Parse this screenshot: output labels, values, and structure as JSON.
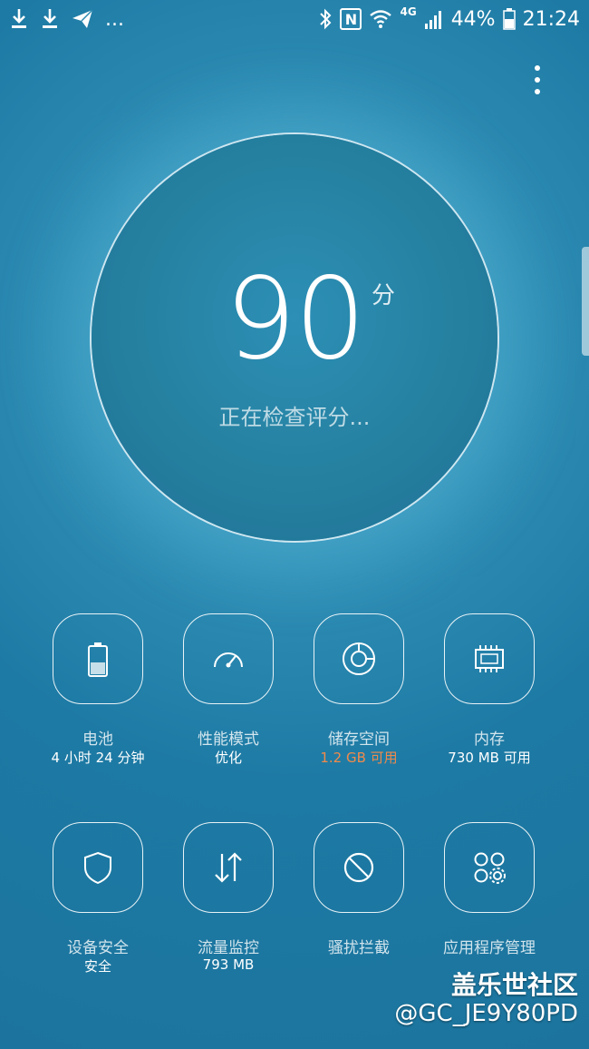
{
  "status_bar": {
    "left_icons": [
      "download-icon",
      "download-icon",
      "send-icon"
    ],
    "overflow": "...",
    "bluetooth_icon": "bluetooth-icon",
    "nfc_label": "N",
    "wifi_icon": "wifi-icon",
    "network_type": "4G",
    "signal_icon": "signal-icon",
    "battery_percent": "44%",
    "battery_icon": "battery-icon",
    "time": "21:24"
  },
  "menu": {
    "icon": "more-vert-icon"
  },
  "score": {
    "value": "90",
    "unit": "分",
    "status": "正在检查评分..."
  },
  "tiles": [
    {
      "icon": "battery-icon",
      "label": "电池",
      "sub": "4 小时 24 分钟",
      "sub_color": "#ffffff"
    },
    {
      "icon": "speedometer-icon",
      "label": "性能模式",
      "sub": "优化",
      "sub_color": "#ffffff"
    },
    {
      "icon": "storage-pie-icon",
      "label": "储存空间",
      "sub": "1.2 GB 可用",
      "sub_color": "#f08a4b"
    },
    {
      "icon": "memory-chip-icon",
      "label": "内存",
      "sub": "730 MB 可用",
      "sub_color": "#ffffff"
    },
    {
      "icon": "shield-icon",
      "label": "设备安全",
      "sub": "安全",
      "sub_color": "#ffffff"
    },
    {
      "icon": "data-transfer-icon",
      "label": "流量监控",
      "sub": "793 MB",
      "sub_color": "#ffffff"
    },
    {
      "icon": "block-icon",
      "label": "骚扰拦截",
      "sub": "",
      "sub_color": "#ffffff"
    },
    {
      "icon": "app-settings-icon",
      "label": "应用程序管理",
      "sub": "",
      "sub_color": "#ffffff"
    }
  ],
  "watermark": {
    "site": "盖乐世社区",
    "user": "@GC_JE9Y80PD"
  },
  "colors": {
    "accent_orange": "#f08a4b",
    "background": "#2a88b0"
  }
}
